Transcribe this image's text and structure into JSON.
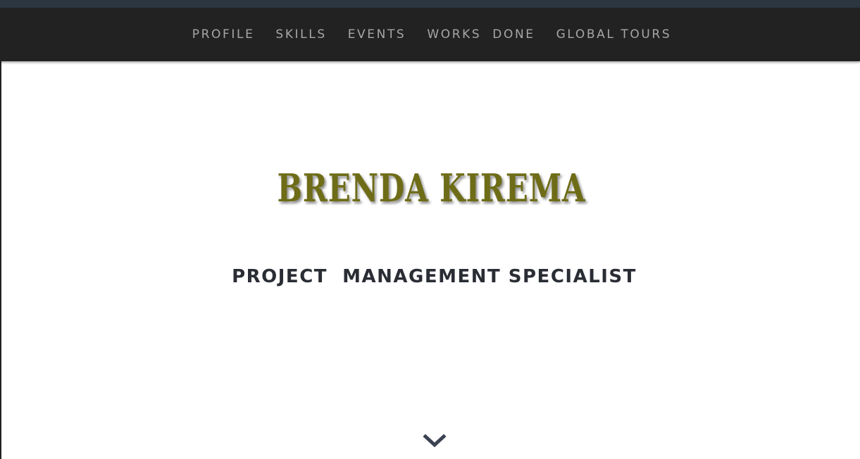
{
  "nav": {
    "items": [
      {
        "label": "PROFILE"
      },
      {
        "label": "SKILLS"
      },
      {
        "label": "EVENTS"
      },
      {
        "label": "WORKS  DONE"
      },
      {
        "label": "GLOBAL TOURS"
      }
    ]
  },
  "hero": {
    "name": "BRENDA KIREMA",
    "title": "PROJECT  MANAGEMENT SPECIALIST",
    "scroll_icon": "chevron-down-icon"
  },
  "colors": {
    "navbar_bg": "#222222",
    "nav_text": "#a6a6a6",
    "name_color": "#6e6c17",
    "title_color": "#2a2d34",
    "chevron_color": "#3b4352"
  }
}
